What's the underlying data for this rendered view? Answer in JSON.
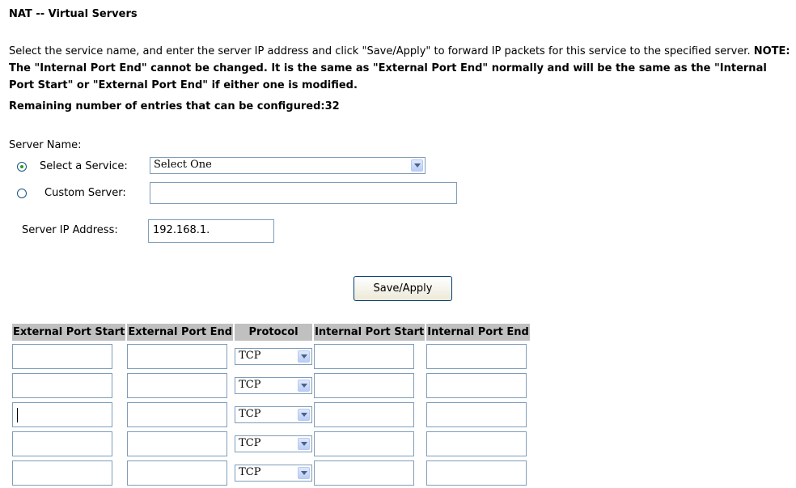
{
  "page": {
    "title": "NAT -- Virtual Servers",
    "description_intro": "Select the service name, and enter the server IP address and click \"Save/Apply\" to forward IP packets for this service to the specified server. ",
    "description_note": "NOTE: The \"Internal Port End\" cannot be changed. It is the same as \"External Port End\" normally and will be the same as the \"Internal Port Start\" or \"External Port End\" if either one is modified.",
    "remaining_entries": "Remaining number of entries that can be configured:32"
  },
  "form": {
    "server_name_label": "Server Name:",
    "select_service_label": "Select a Service:",
    "select_service_value": "Select One",
    "custom_server_label": "Custom Server:",
    "custom_server_value": "",
    "server_ip_label": "Server IP Address:",
    "server_ip_value": "192.168.1.",
    "selected_option": "select_service"
  },
  "actions": {
    "save_apply_label": "Save/Apply"
  },
  "table": {
    "headers": [
      "External Port Start",
      "External Port End",
      "Protocol",
      "Internal Port Start",
      "Internal Port End"
    ],
    "rows": [
      {
        "ext_start": "",
        "ext_end": "",
        "protocol": "TCP",
        "int_start": "",
        "int_end": ""
      },
      {
        "ext_start": "",
        "ext_end": "",
        "protocol": "TCP",
        "int_start": "",
        "int_end": ""
      },
      {
        "ext_start": "",
        "ext_end": "",
        "protocol": "TCP",
        "int_start": "",
        "int_end": ""
      },
      {
        "ext_start": "",
        "ext_end": "",
        "protocol": "TCP",
        "int_start": "",
        "int_end": ""
      },
      {
        "ext_start": "",
        "ext_end": "",
        "protocol": "TCP",
        "int_start": "",
        "int_end": ""
      }
    ]
  },
  "icons": {
    "radio_selected": "radio-selected-icon",
    "radio_unselected": "radio-unselected-icon",
    "dropdown": "chevron-down-icon"
  }
}
